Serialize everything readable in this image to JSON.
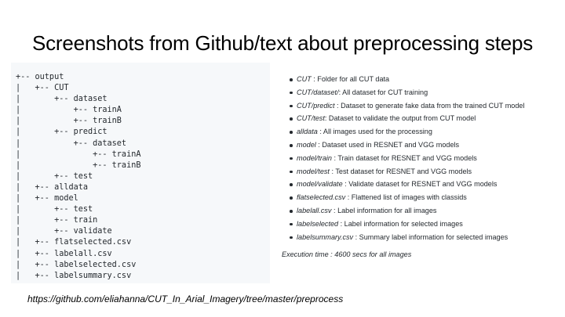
{
  "slide": {
    "title": "Screenshots from Github/text about preprocessing steps",
    "source_url": "https://github.com/eliahanna/CUT_In_Arial_Imagery/tree/master/preprocess"
  },
  "tree": {
    "lines": [
      "+-- output",
      "|   +-- CUT",
      "|       +-- dataset",
      "|           +-- trainA",
      "|           +-- trainB",
      "|       +-- predict",
      "|           +-- dataset",
      "|               +-- trainA",
      "|               +-- trainB",
      "|       +-- test",
      "|   +-- alldata",
      "|   +-- model",
      "|       +-- test",
      "|       +-- train",
      "|       +-- validate",
      "|   +-- flatselected.csv",
      "|   +-- labelall.csv",
      "|   +-- labelselected.csv",
      "|   +-- labelsummary.csv"
    ]
  },
  "notes": {
    "items": [
      {
        "term": "CUT",
        "desc": " : Folder for all CUT data"
      },
      {
        "term": "CUT/dataset/",
        "desc": ": All dataset for CUT training"
      },
      {
        "term": "CUT/predict",
        "desc": " : Dataset to generate fake data from the trained CUT model"
      },
      {
        "term": "CUT/test",
        "desc": ": Dataset to validate the output from CUT model"
      },
      {
        "term": "alldata",
        "desc": " : All images used for the processing"
      },
      {
        "term": "model",
        "desc": " : Dataset used in RESNET and VGG models"
      },
      {
        "term": "model/train",
        "desc": " : Train dataset for RESNET and VGG models"
      },
      {
        "term": "model/test",
        "desc": " : Test dataset for RESNET and VGG models"
      },
      {
        "term": "model/validate",
        "desc": " : Validate dataset for RESNET and VGG models"
      },
      {
        "term": "flatselected.csv",
        "desc": " : Flattened list of images with classids"
      },
      {
        "term": "labelall.csv",
        "desc": " : Label information for all images"
      },
      {
        "term": "labelselected",
        "desc": " : Label information for selected images"
      },
      {
        "term": "labelsummary.csv",
        "desc": " : Summary label information for selected images"
      }
    ],
    "execution_time": "Execution time : 4600 secs for all images"
  }
}
